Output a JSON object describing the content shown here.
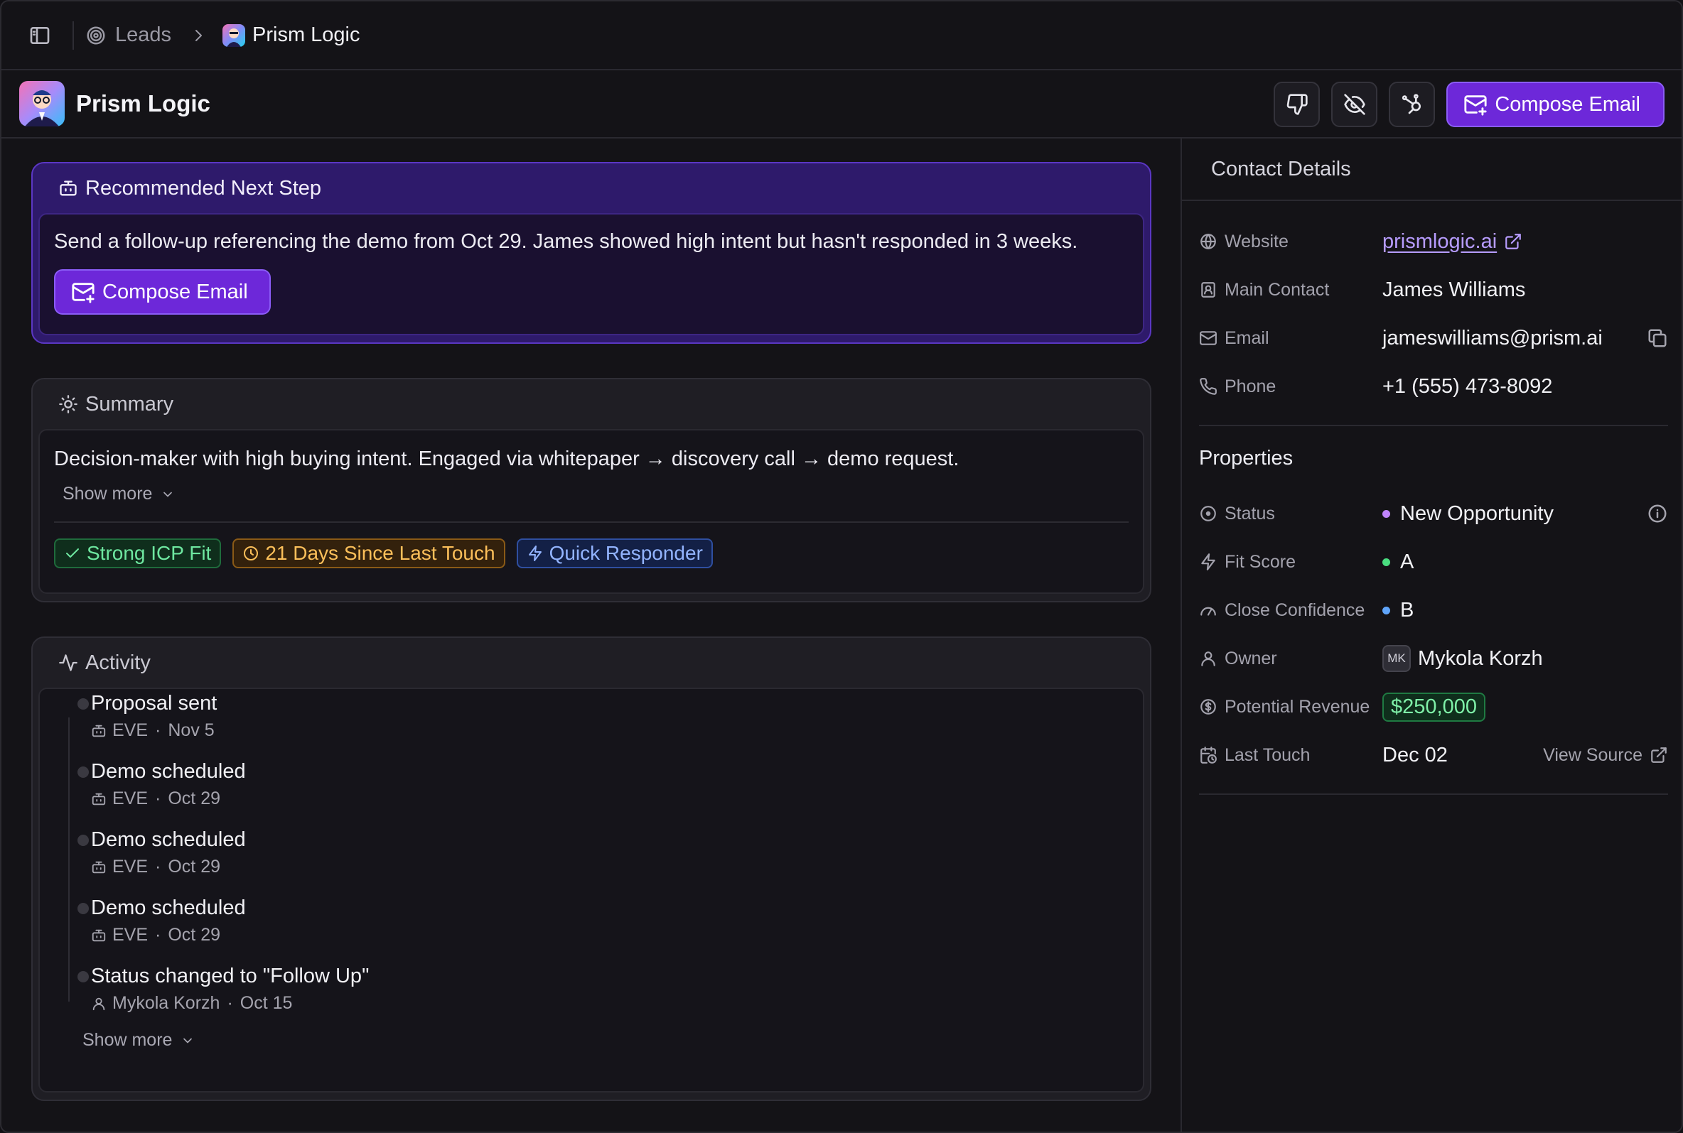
{
  "breadcrumb": {
    "section": "Leads",
    "current": "Prism Logic"
  },
  "header": {
    "title": "Prism Logic",
    "compose_label": "Compose Email"
  },
  "recommendation": {
    "heading": "Recommended Next Step",
    "text": "Send a follow-up referencing the demo from Oct 29. James showed high intent but hasn't responded in 3 weeks.",
    "button_label": "Compose Email"
  },
  "summary": {
    "heading": "Summary",
    "text": "Decision-maker with high buying intent. Engaged via whitepaper → discovery call → demo request.",
    "show_more": "Show more",
    "tags": [
      "Strong ICP Fit",
      "21 Days Since Last Touch",
      "Quick Responder"
    ]
  },
  "activity": {
    "heading": "Activity",
    "items": [
      {
        "title": "Proposal sent",
        "actor": "EVE",
        "date": "Nov 5"
      },
      {
        "title": "Demo scheduled",
        "actor": "EVE",
        "date": "Oct 29"
      },
      {
        "title": "Demo scheduled",
        "actor": "EVE",
        "date": "Oct 29"
      },
      {
        "title": "Demo scheduled",
        "actor": "EVE",
        "date": "Oct 29"
      },
      {
        "title": "Status changed to \"Follow Up\"",
        "actor": "Mykola Korzh",
        "date": "Oct 15"
      }
    ],
    "show_more": "Show more"
  },
  "contact": {
    "heading": "Contact Details",
    "website_label": "Website",
    "website": "prismlogic.ai",
    "main_contact_label": "Main Contact",
    "main_contact": "James Williams",
    "email_label": "Email",
    "email": "jameswilliams@prism.ai",
    "phone_label": "Phone",
    "phone": "+1 (555) 473-8092"
  },
  "properties": {
    "heading": "Properties",
    "status_label": "Status",
    "status": "New Opportunity",
    "fit_label": "Fit Score",
    "fit": "A",
    "confidence_label": "Close Confidence",
    "confidence": "B",
    "owner_label": "Owner",
    "owner_initials": "MK",
    "owner": "Mykola Korzh",
    "revenue_label": "Potential Revenue",
    "revenue": "$250,000",
    "last_touch_label": "Last Touch",
    "last_touch": "Dec 02",
    "view_source": "View Source"
  },
  "colors": {
    "accent": "#6d28d9",
    "status_dot": "#c084fc",
    "fit_dot": "#4ade80",
    "confidence_dot": "#60a5fa"
  }
}
